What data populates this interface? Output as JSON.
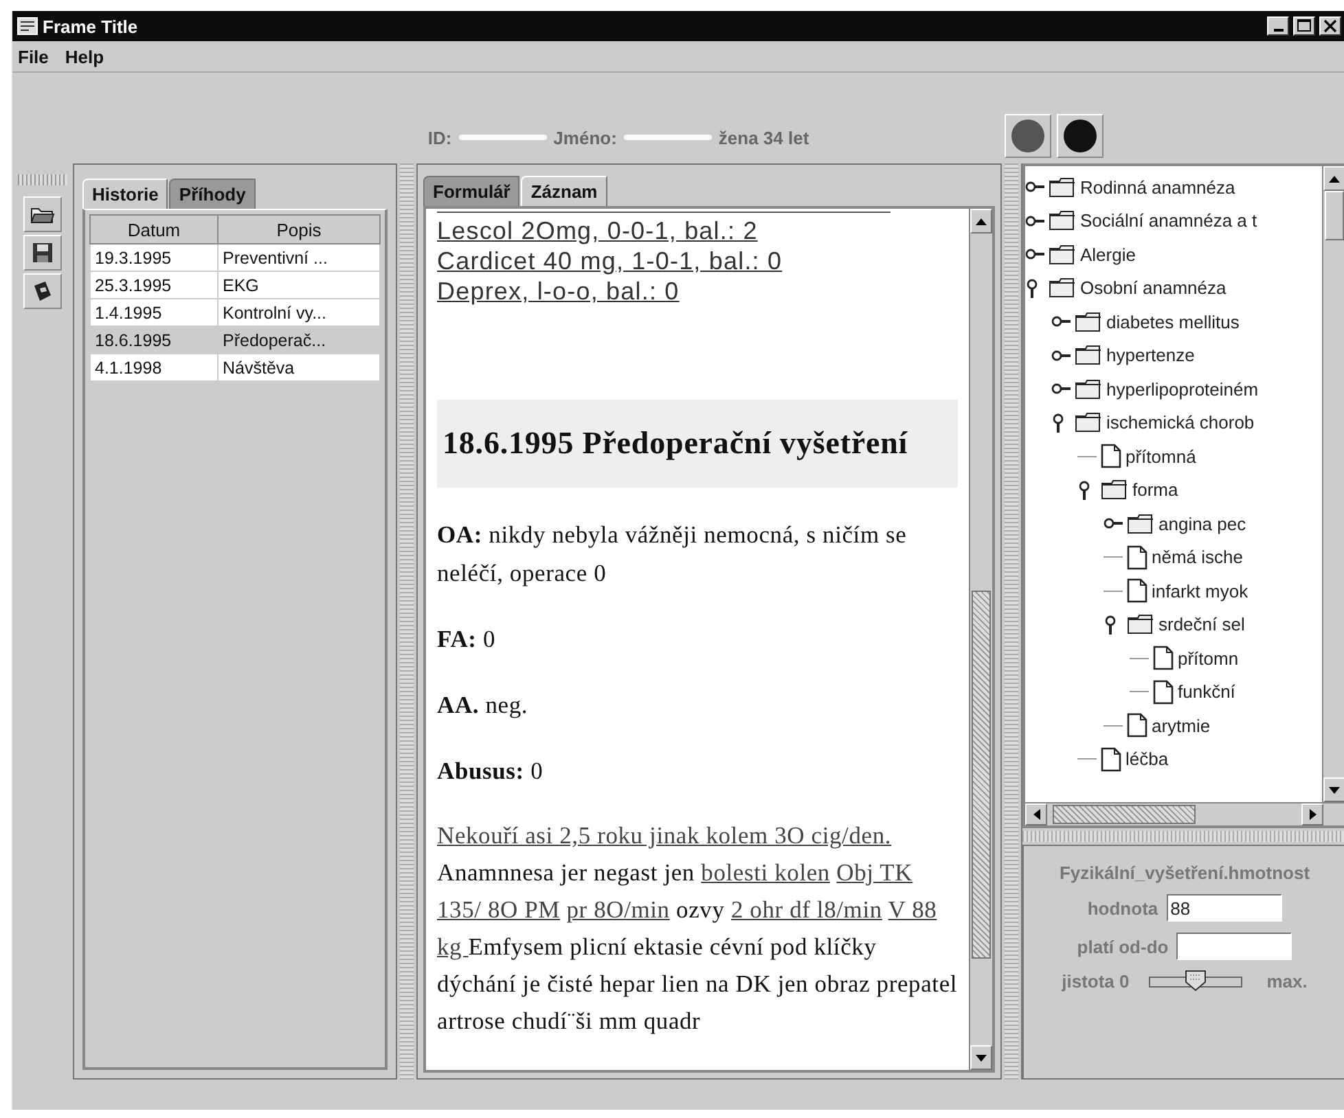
{
  "window": {
    "title": "Frame Title"
  },
  "menu": [
    "File",
    "Help"
  ],
  "patient": {
    "id_label": "ID:",
    "name_label": "Jméno:",
    "details": "žena 34 let"
  },
  "status_lights": [
    {
      "color": "#555555"
    },
    {
      "color": "#111111"
    }
  ],
  "history_tabs": [
    {
      "label": "Historie",
      "selected": true
    },
    {
      "label": "Příhody",
      "selected": false
    }
  ],
  "history_table": {
    "columns": [
      "Datum",
      "Popis"
    ],
    "rows": [
      {
        "cells": [
          "19.3.1995",
          "Preventivní ..."
        ],
        "selected": false
      },
      {
        "cells": [
          "25.3.1995",
          "EKG"
        ],
        "selected": false
      },
      {
        "cells": [
          "1.4.1995",
          "Kontrolní vy..."
        ],
        "selected": false
      },
      {
        "cells": [
          "18.6.1995",
          "Předoperač..."
        ],
        "selected": true
      },
      {
        "cells": [
          "4.1.1998",
          "Návštěva"
        ],
        "selected": false
      }
    ]
  },
  "record_tabs": [
    {
      "label": "Formulář",
      "selected": false
    },
    {
      "label": "Záznam",
      "selected": true
    }
  ],
  "record": {
    "links": [
      "Lescol 2Omg, 0-0-1, bal.: 2",
      "Cardicet 40 mg, 1-0-1, bal.: 0",
      "Deprex, l-o-o, bal.: 0"
    ],
    "heading": "18.6.1995 Předoperační vyšetření",
    "fields": [
      "**OA:**  nikdy nebyla vážněji nemocná, s ničím se neléčí, operace 0",
      "**FA:** 0",
      "**AA.** neg.",
      "**Abusus:** 0"
    ],
    "paragraph": [
      {
        "text": "Nekouří asi 2,5 roku jinak kolem 3O cig/den.",
        "underlined": true
      },
      {
        "text": " Anamnnesa jer negast jen ",
        "underlined": false
      },
      {
        "text": "bolesti kolen",
        "underlined": true
      },
      {
        "text": "Obj TK 135/ 8O PM",
        "underlined": true
      },
      {
        "text": "pr 8O/min",
        "underlined": true
      },
      {
        "text": " ozvy ",
        "underlined": false
      },
      {
        "text": "2 ohr df l8/min",
        "underlined": true
      },
      {
        "text": "V 88 kg ",
        "underlined": true
      },
      {
        "text": " Emfysem plicní ektasie cévní pod klíčky dýchání je čisté hepar lien na DK jen obraz prepatel artrose chudí¨ši mm quadr",
        "underlined": false
      }
    ]
  },
  "tree": [
    {
      "label": "Rodinná anamnéza",
      "kind": "folder",
      "expanded": false
    },
    {
      "label": "Sociální anamnéza a t",
      "kind": "folder",
      "expanded": false
    },
    {
      "label": "Alergie",
      "kind": "folder",
      "expanded": false
    },
    {
      "label": "Osobní anamnéza",
      "kind": "folder",
      "expanded": true,
      "children": [
        {
          "label": "diabetes mellitus",
          "kind": "folder",
          "expanded": false
        },
        {
          "label": "hypertenze",
          "kind": "folder",
          "expanded": false
        },
        {
          "label": "hyperlipoproteiném",
          "kind": "folder",
          "expanded": false
        },
        {
          "label": "ischemická chorob",
          "kind": "folder",
          "expanded": true,
          "children": [
            {
              "label": "přítomná",
              "kind": "leaf"
            },
            {
              "label": "forma",
              "kind": "folder",
              "expanded": true,
              "children": [
                {
                  "label": "angina pec",
                  "kind": "folder",
                  "expanded": false
                },
                {
                  "label": "němá ische",
                  "kind": "leaf"
                },
                {
                  "label": "infarkt myok",
                  "kind": "leaf"
                },
                {
                  "label": "srdeční sel",
                  "kind": "folder",
                  "expanded": true,
                  "children": [
                    {
                      "label": "přítomn",
                      "kind": "leaf"
                    },
                    {
                      "label": "funkční",
                      "kind": "leaf"
                    }
                  ]
                },
                {
                  "label": "arytmie",
                  "kind": "leaf"
                }
              ]
            },
            {
              "label": "léčba",
              "kind": "leaf"
            }
          ]
        }
      ]
    }
  ],
  "detail": {
    "title": "Fyzikální_vyšetření.hmotnost",
    "fields": [
      {
        "label": "hodnota",
        "value": "88"
      },
      {
        "label": "platí od-do"
      }
    ],
    "slider": {
      "label": "jistota 0",
      "level": 0.5,
      "max_label": "max."
    }
  }
}
